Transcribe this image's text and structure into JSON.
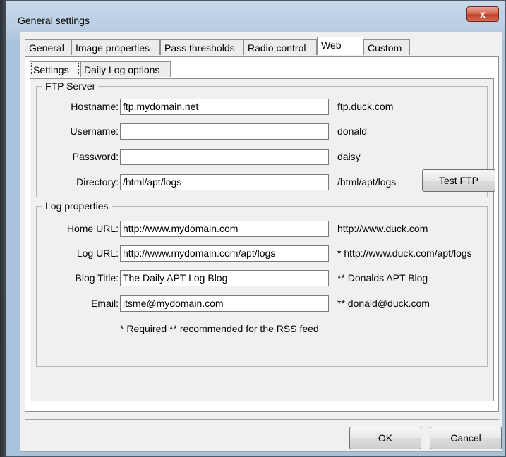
{
  "window": {
    "title": "General settings",
    "close_glyph": "x"
  },
  "tabs": [
    {
      "label": "General"
    },
    {
      "label": "Image properties"
    },
    {
      "label": "Pass thresholds"
    },
    {
      "label": "Radio control"
    },
    {
      "label": "Web"
    },
    {
      "label": "Custom"
    }
  ],
  "subtabs": [
    {
      "label": "Settings"
    },
    {
      "label": "Daily Log options"
    }
  ],
  "ftp": {
    "legend": "FTP Server",
    "hostname_label": "Hostname:",
    "hostname_value": "ftp.mydomain.net",
    "hostname_hint": "ftp.duck.com",
    "username_label": "Username:",
    "username_value": "",
    "username_hint": "donald",
    "password_label": "Password:",
    "password_value": "",
    "password_hint": "daisy",
    "directory_label": "Directory:",
    "directory_value": "/html/apt/logs",
    "directory_hint": "/html/apt/logs",
    "test_button": "Test FTP"
  },
  "log": {
    "legend": "Log properties",
    "home_url_label": "Home URL:",
    "home_url_value": "http://www.mydomain.com",
    "home_url_hint": "http://www.duck.com",
    "log_url_label": "Log URL:",
    "log_url_value": "http://www.mydomain.com/apt/logs",
    "log_url_hint": "* http://www.duck.com/apt/logs",
    "blog_title_label": "Blog Title:",
    "blog_title_value": "The Daily APT Log Blog",
    "blog_title_hint": "** Donalds APT Blog",
    "email_label": "Email:",
    "email_value": "itsme@mydomain.com",
    "email_hint": "** donald@duck.com",
    "footnote": "* Required ** recommended for the RSS feed"
  },
  "buttons": {
    "ok": "OK",
    "cancel": "Cancel"
  }
}
